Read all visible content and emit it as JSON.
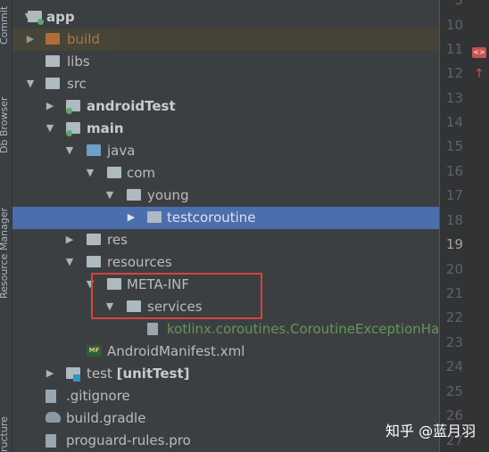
{
  "side_tabs": [
    "Commit",
    "Db Browser",
    "Resource Manager",
    "ructure"
  ],
  "tree": {
    "app": "app",
    "build": "build",
    "libs": "libs",
    "src": "src",
    "androidTest": "androidTest",
    "main": "main",
    "java": "java",
    "com": "com",
    "young": "young",
    "testcoroutine": "testcoroutine",
    "res": "res",
    "resources": "resources",
    "meta_inf": "META-INF",
    "services": "services",
    "kotlinx_file": "kotlinx.coroutines.CoroutineExceptionHandler",
    "manifest": "AndroidManifest.xml",
    "manifest_badge": "MF",
    "test": "test",
    "unittest": "[unitTest]",
    "gitignore": ".gitignore",
    "build_gradle": "build.gradle",
    "proguard": "proguard-rules.pro"
  },
  "line_numbers": [
    "3",
    "10",
    "11",
    "12",
    "13",
    "14",
    "15",
    "16",
    "17",
    "18",
    "19",
    "20",
    "21",
    "22",
    "23",
    "24",
    "25",
    "26",
    "27"
  ],
  "current_line": "19",
  "watermark": "知乎 @蓝月羽",
  "colors": {
    "selection": "#4b6eaf",
    "highlight_box": "#d9433b",
    "kotlin_file_text": "#629755"
  }
}
